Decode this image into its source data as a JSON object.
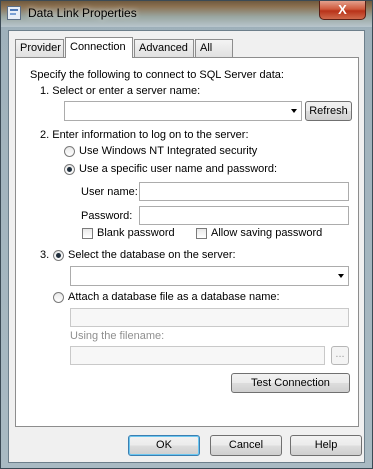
{
  "window": {
    "title": "Data Link Properties",
    "close_label": "X"
  },
  "tabs": [
    {
      "label": "Provider"
    },
    {
      "label": "Connection"
    },
    {
      "label": "Advanced"
    },
    {
      "label": "All"
    }
  ],
  "connection": {
    "intro": "Specify the following to connect to SQL Server data:",
    "step1": {
      "label": "1. Select or enter a server name:",
      "server_value": "",
      "refresh_label": "Refresh"
    },
    "step2": {
      "label": "2. Enter information to log on to the server:",
      "radio_nt": "Use Windows NT Integrated security",
      "radio_specific": "Use a specific user name and password:",
      "selected": "specific",
      "username_label": "User name:",
      "username_value": "",
      "password_label": "Password:",
      "password_value": "",
      "blank_password_label": "Blank password",
      "blank_password_checked": false,
      "allow_saving_label": "Allow saving password",
      "allow_saving_checked": false
    },
    "step3": {
      "number": "3.",
      "radio_select_db": "Select the database on the server:",
      "database_value": "",
      "radio_attach": "Attach a database file as a database name:",
      "attach_name_value": "",
      "using_filename_label": "Using the filename:",
      "filename_value": "",
      "browse_label": "...",
      "selected": "select"
    },
    "test_connection_label": "Test Connection"
  },
  "footer": {
    "ok_label": "OK",
    "cancel_label": "Cancel",
    "help_label": "Help"
  }
}
